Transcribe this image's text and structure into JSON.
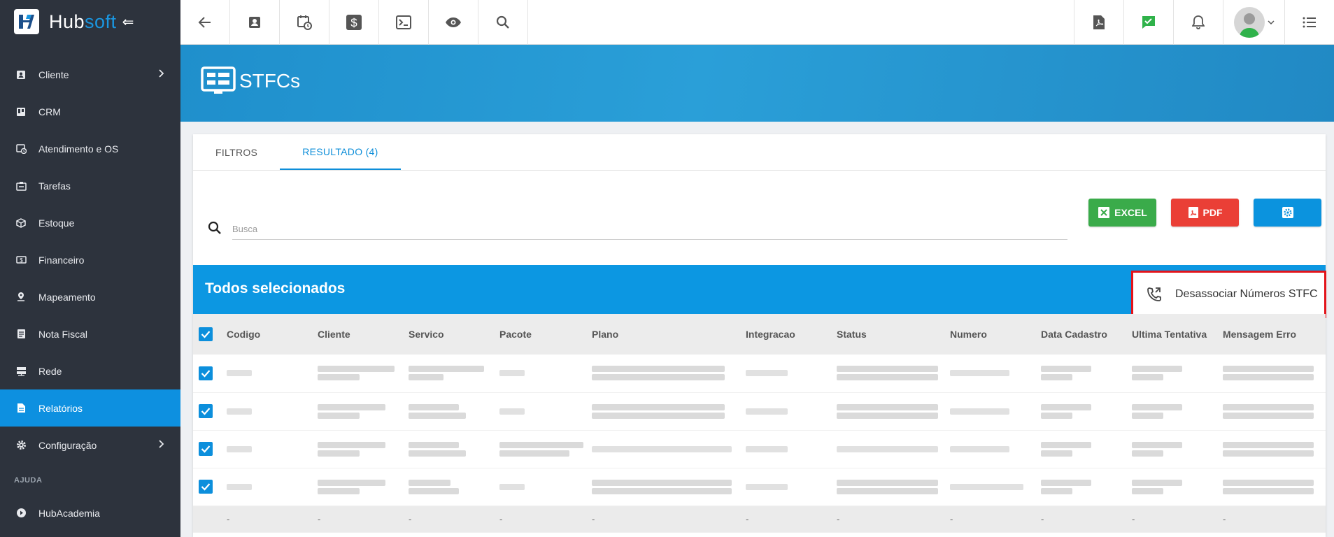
{
  "brand": {
    "name_hub": "Hub",
    "name_soft": "soft",
    "collapse_glyph": "⇐"
  },
  "sidebar": {
    "items": [
      {
        "label": "Cliente",
        "icon": "contact-card-icon",
        "has_chevron": true
      },
      {
        "label": "CRM",
        "icon": "board-icon"
      },
      {
        "label": "Atendimento e OS",
        "icon": "calendar-clock-icon"
      },
      {
        "label": "Tarefas",
        "icon": "task-icon"
      },
      {
        "label": "Estoque",
        "icon": "box-icon"
      },
      {
        "label": "Financeiro",
        "icon": "money-icon"
      },
      {
        "label": "Mapeamento",
        "icon": "map-pin-icon"
      },
      {
        "label": "Nota Fiscal",
        "icon": "invoice-icon"
      },
      {
        "label": "Rede",
        "icon": "server-icon"
      },
      {
        "label": "Relatórios",
        "icon": "report-icon",
        "active": true
      },
      {
        "label": "Configuração",
        "icon": "gear-icon",
        "has_chevron": true
      }
    ],
    "section_help": "AJUDA",
    "help_items": [
      {
        "label": "HubAcademia",
        "icon": "play-icon"
      }
    ]
  },
  "topbar": {
    "left_icons": [
      "back-arrow-icon",
      "contact-card-icon",
      "calendar-clock-icon",
      "dollar-icon",
      "terminal-icon",
      "eye-icon",
      "search-icon"
    ],
    "right_icons": [
      "pdf-file-icon",
      "chat-check-icon",
      "bell-icon"
    ],
    "menu_icon": "list-icon"
  },
  "page": {
    "title": "STFCs"
  },
  "tabs": [
    {
      "label": "FILTROS"
    },
    {
      "label": "RESULTADO (4)",
      "active": true
    }
  ],
  "search": {
    "placeholder": "Busca"
  },
  "buttons": {
    "excel": "EXCEL",
    "pdf": "PDF"
  },
  "selection": {
    "title": "Todos selecionados",
    "action_label": "Desassociar Números STFC"
  },
  "table": {
    "columns": [
      "Codigo",
      "Cliente",
      "Servico",
      "Pacote",
      "Plano",
      "Integracao",
      "Status",
      "Numero",
      "Data Cadastro",
      "Ultima Tentativa",
      "Mensagem Erro"
    ],
    "rows_checked": [
      true,
      true,
      true,
      true
    ],
    "footer": [
      "-",
      "-",
      "-",
      "-",
      "-",
      "-",
      "-",
      "-",
      "-",
      "-",
      "-"
    ]
  },
  "colors": {
    "sidebar_bg": "#2d333d",
    "accent": "#0c97e2",
    "excel": "#3aab4a",
    "pdf": "#ea3f36",
    "highlight_border": "#e3141b"
  }
}
